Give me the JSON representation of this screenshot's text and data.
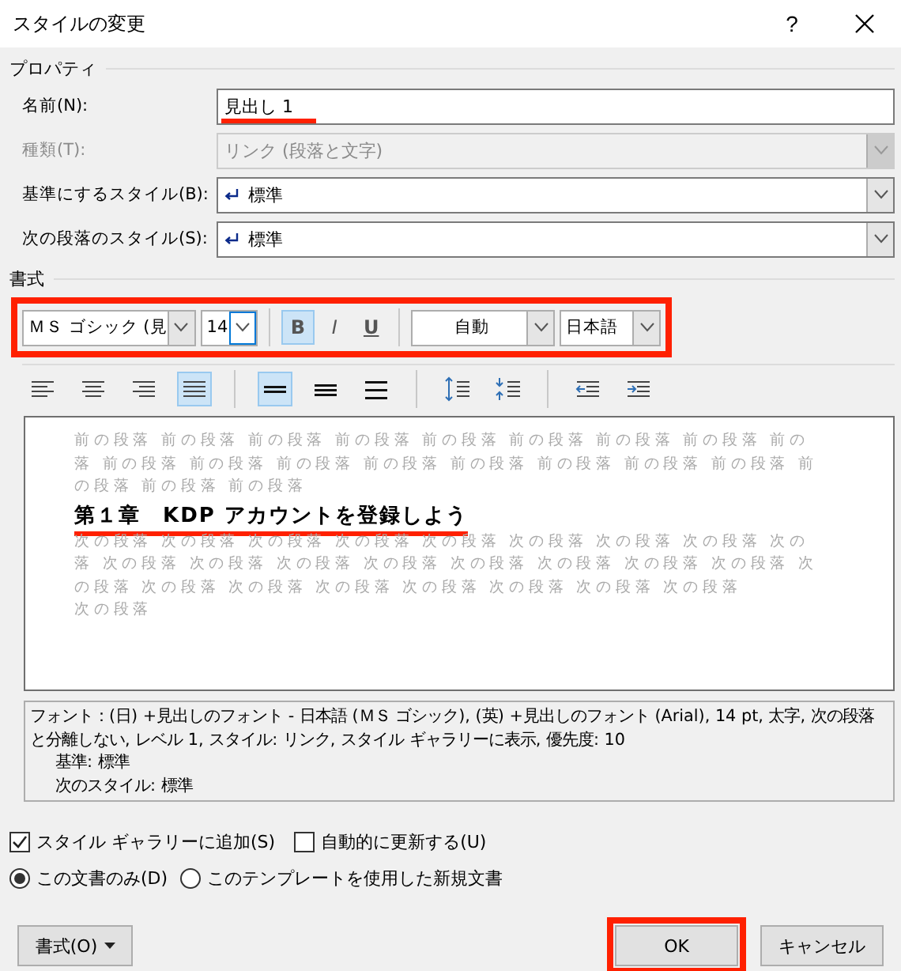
{
  "window": {
    "title": "スタイルの変更",
    "help": "?"
  },
  "properties": {
    "legend": "プロパティ",
    "rows": [
      {
        "label": "名前(N):",
        "kind": "text",
        "value": "見出し 1",
        "disabled": false,
        "highlighted": true
      },
      {
        "label": "種類(T):",
        "kind": "combo",
        "value": "リンク (段落と文字)",
        "disabled": true,
        "highlighted": false
      },
      {
        "label": "基準にするスタイル(B):",
        "kind": "combo",
        "value": "標準",
        "disabled": false,
        "highlighted": false
      },
      {
        "label": "次の段落のスタイル(S):",
        "kind": "combo",
        "value": "標準",
        "disabled": false,
        "highlighted": false
      }
    ]
  },
  "format": {
    "legend": "書式",
    "highlighted": true,
    "font": "ＭＳ ゴシック (見",
    "size": "14",
    "size_focused": true,
    "styles": [
      {
        "label": "B",
        "selected": true
      },
      {
        "label": "I",
        "selected": false
      },
      {
        "label": "U",
        "selected": false
      }
    ],
    "font_color": "自動",
    "language": "日本語"
  },
  "paragraph_tools": [
    {
      "kind": "align-left",
      "selected": false
    },
    {
      "kind": "align-center",
      "selected": false
    },
    {
      "kind": "align-right",
      "selected": false
    },
    {
      "kind": "justify",
      "selected": true
    },
    {
      "kind": "spacing-single",
      "selected": true
    },
    {
      "kind": "spacing-half",
      "selected": false
    },
    {
      "kind": "spacing-double",
      "selected": false
    },
    {
      "kind": "space-before",
      "selected": false
    },
    {
      "kind": "space-after",
      "selected": false
    },
    {
      "kind": "indent-decrease",
      "selected": false
    },
    {
      "kind": "indent-increase",
      "selected": false
    }
  ],
  "preview": {
    "before": [
      "前の段落 前の段落 前の段落 前の段落 前の段落 前の段落 前の段落 前の段落 前の",
      "落 前の段落 前の段落 前の段落 前の段落 前の段落 前の段落 前の段落 前の段落 前",
      "の段落 前の段落 前の段落"
    ],
    "heading": "第１章　KDP アカウントを登録しよう",
    "highlighted": true,
    "after": [
      "次の段落 次の段落 次の段落 次の段落 次の段落 次の段落 次の段落 次の段落 次の",
      "落 次の段落 次の段落 次の段落 次の段落 次の段落 次の段落 次の段落 次の段落 次",
      "の段落 次の段落 次の段落 次の段落 次の段落 次の段落 次の段落 次の段落",
      "次の段落"
    ]
  },
  "description": [
    {
      "kind": "main",
      "text": "フォント：(日) +見出しのフォント - 日本語 (ＭＳ ゴシック), (英) +見出しのフォント (Arial), 14 pt, 太字, 次の段落と分離しない, レベル 1, スタイル: リンク, スタイル ギャラリーに表示, 優先度: 10"
    },
    {
      "kind": "sub",
      "text": "基準: 標準"
    },
    {
      "kind": "sub",
      "text": "次のスタイル: 標準"
    }
  ],
  "checkboxes": [
    {
      "label": "スタイル ギャラリーに追加(S)",
      "checked": true
    },
    {
      "label": "自動的に更新する(U)",
      "checked": false
    }
  ],
  "radios": [
    {
      "label": "この文書のみ(D)",
      "selected": true
    },
    {
      "label": "このテンプレートを使用した新規文書",
      "selected": false
    }
  ],
  "buttons": [
    {
      "kind": "menu",
      "label": "書式(O)",
      "highlighted": false
    },
    {
      "kind": "ok",
      "label": "OK",
      "highlighted": true
    },
    {
      "kind": "cancel",
      "label": "キャンセル",
      "highlighted": false
    }
  ]
}
